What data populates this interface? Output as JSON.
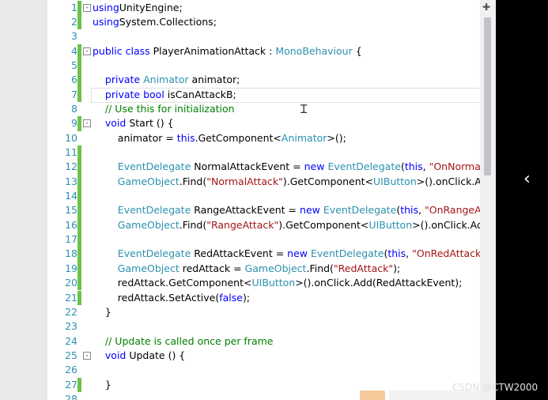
{
  "editor": {
    "lines": [
      {
        "n": "1",
        "fold": "-",
        "changed": true,
        "tokens": [
          [
            "kw",
            "using"
          ],
          [
            "",
            "UnityEngine;"
          ]
        ]
      },
      {
        "n": "2",
        "changed": true,
        "tokens": [
          [
            "kw",
            "using"
          ],
          [
            "",
            "System.Collections;"
          ]
        ]
      },
      {
        "n": "3",
        "changed": false,
        "tokens": []
      },
      {
        "n": "4",
        "fold": "-",
        "changed": true,
        "tokens": [
          [
            "kw",
            "public"
          ],
          [
            "",
            " "
          ],
          [
            "kw",
            "class"
          ],
          [
            "",
            " PlayerAnimationAttack : "
          ],
          [
            "ty",
            "MonoBehaviour"
          ],
          [
            "",
            " {"
          ]
        ]
      },
      {
        "n": "5",
        "changed": true,
        "tokens": []
      },
      {
        "n": "6",
        "changed": true,
        "tokens": [
          [
            "",
            "    "
          ],
          [
            "kw",
            "private"
          ],
          [
            "",
            " "
          ],
          [
            "ty",
            "Animator"
          ],
          [
            "",
            " animator;"
          ]
        ]
      },
      {
        "n": "7",
        "changed": true,
        "current": true,
        "tokens": [
          [
            "",
            "    "
          ],
          [
            "kw",
            "private"
          ],
          [
            "",
            " "
          ],
          [
            "kw",
            "bool"
          ],
          [
            "",
            " isCanAttackB;"
          ]
        ]
      },
      {
        "n": "8",
        "changed": false,
        "tokens": [
          [
            "",
            "    "
          ],
          [
            "cm",
            "// Use this for initialization"
          ]
        ]
      },
      {
        "n": "9",
        "fold": "-",
        "changed": true,
        "tokens": [
          [
            "",
            "    "
          ],
          [
            "kw",
            "void"
          ],
          [
            "",
            " Start () {"
          ]
        ]
      },
      {
        "n": "10",
        "changed": false,
        "tokens": [
          [
            "",
            "        animator = "
          ],
          [
            "kw",
            "this"
          ],
          [
            "",
            ".GetComponent<"
          ],
          [
            "ty",
            "Animator"
          ],
          [
            "",
            ">();"
          ]
        ]
      },
      {
        "n": "11",
        "changed": true,
        "tokens": []
      },
      {
        "n": "12",
        "changed": true,
        "tokens": [
          [
            "",
            "        "
          ],
          [
            "ty",
            "EventDelegate"
          ],
          [
            "",
            " NormalAttackEvent = "
          ],
          [
            "kw",
            "new"
          ],
          [
            "",
            " "
          ],
          [
            "ty",
            "EventDelegate"
          ],
          [
            "",
            "("
          ],
          [
            "kw",
            "this"
          ],
          [
            "",
            ", "
          ],
          [
            "st",
            "\"OnNormalAttackC"
          ]
        ]
      },
      {
        "n": "13",
        "changed": true,
        "tokens": [
          [
            "",
            "        "
          ],
          [
            "ty",
            "GameObject"
          ],
          [
            "",
            ".Find("
          ],
          [
            "st",
            "\"NormalAttack\""
          ],
          [
            "",
            ").GetComponent<"
          ],
          [
            "ty",
            "UIButton"
          ],
          [
            "",
            ">().onClick.Add(Nor"
          ]
        ]
      },
      {
        "n": "14",
        "changed": true,
        "tokens": []
      },
      {
        "n": "15",
        "changed": true,
        "tokens": [
          [
            "",
            "        "
          ],
          [
            "ty",
            "EventDelegate"
          ],
          [
            "",
            " RangeAttackEvent = "
          ],
          [
            "kw",
            "new"
          ],
          [
            "",
            " "
          ],
          [
            "ty",
            "EventDelegate"
          ],
          [
            "",
            "("
          ],
          [
            "kw",
            "this"
          ],
          [
            "",
            ", "
          ],
          [
            "st",
            "\"OnRangeAttackClick"
          ]
        ]
      },
      {
        "n": "16",
        "changed": true,
        "tokens": [
          [
            "",
            "        "
          ],
          [
            "ty",
            "GameObject"
          ],
          [
            "",
            ".Find("
          ],
          [
            "st",
            "\"RangeAttack\""
          ],
          [
            "",
            ").GetComponent<"
          ],
          [
            "ty",
            "UIButton"
          ],
          [
            "",
            ">().onClick.Add(Range"
          ]
        ]
      },
      {
        "n": "17",
        "changed": true,
        "tokens": []
      },
      {
        "n": "18",
        "changed": true,
        "tokens": [
          [
            "",
            "        "
          ],
          [
            "ty",
            "EventDelegate"
          ],
          [
            "",
            " RedAttackEvent = "
          ],
          [
            "kw",
            "new"
          ],
          [
            "",
            " "
          ],
          [
            "ty",
            "EventDelegate"
          ],
          [
            "",
            "("
          ],
          [
            "kw",
            "this"
          ],
          [
            "",
            ", "
          ],
          [
            "st",
            "\"OnRedAttackClick\""
          ],
          [
            "",
            ");"
          ]
        ]
      },
      {
        "n": "19",
        "changed": true,
        "tokens": [
          [
            "",
            "        "
          ],
          [
            "ty",
            "GameObject"
          ],
          [
            "",
            " redAttack = "
          ],
          [
            "ty",
            "GameObject"
          ],
          [
            "",
            ".Find("
          ],
          [
            "st",
            "\"RedAttack\""
          ],
          [
            "",
            ");"
          ]
        ]
      },
      {
        "n": "20",
        "changed": true,
        "tokens": [
          [
            "",
            "        redAttack.GetComponent<"
          ],
          [
            "ty",
            "UIButton"
          ],
          [
            "",
            ">().onClick.Add(RedAttackEvent);"
          ]
        ]
      },
      {
        "n": "21",
        "changed": true,
        "tokens": [
          [
            "",
            "        redAttack.SetActive("
          ],
          [
            "kw",
            "false"
          ],
          [
            "",
            ");"
          ]
        ]
      },
      {
        "n": "22",
        "changed": false,
        "tokens": [
          [
            "",
            "    }"
          ]
        ]
      },
      {
        "n": "23",
        "changed": false,
        "tokens": []
      },
      {
        "n": "24",
        "changed": false,
        "tokens": [
          [
            "",
            "    "
          ],
          [
            "cm",
            "// Update is called once per frame"
          ]
        ]
      },
      {
        "n": "25",
        "fold": "-",
        "changed": false,
        "tokens": [
          [
            "",
            "    "
          ],
          [
            "kw",
            "void"
          ],
          [
            "",
            " Update () {"
          ]
        ]
      },
      {
        "n": "26",
        "changed": false,
        "tokens": []
      },
      {
        "n": "27",
        "changed": true,
        "tokens": [
          [
            "",
            "    }"
          ]
        ]
      },
      {
        "n": "28",
        "changed": false,
        "tokens": []
      }
    ]
  },
  "icons": {
    "split": "split-view-icon",
    "chevron": "chevron-left-icon",
    "cursor": "text-cursor-icon"
  },
  "overlay": {
    "chevron": "‹",
    "watermark": "CSDN @CTW2000"
  },
  "colors": {
    "keyword": "#0000ff",
    "type": "#2b91af",
    "string": "#a31515",
    "comment": "#008000",
    "line_number": "#2b91af",
    "change_bar": "#6cc24a"
  }
}
